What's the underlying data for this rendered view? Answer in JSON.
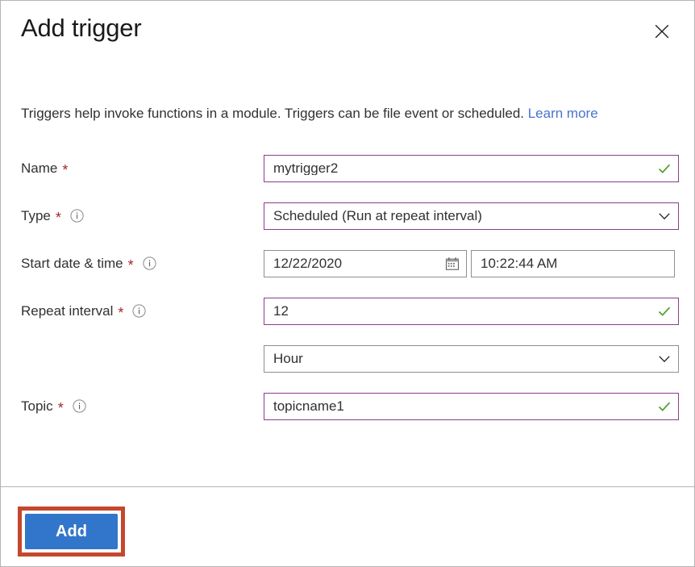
{
  "panel": {
    "title": "Add trigger",
    "close_icon": "close-icon",
    "description_text": "Triggers help invoke functions in a module. Triggers can be file event or scheduled. ",
    "learn_more_label": "Learn more"
  },
  "colors": {
    "accent_button": "#3276cb",
    "annotation": "#c4472e",
    "validated_border": "#8a3c8e",
    "neutral_border": "#8f8f8f",
    "required_star": "#a4262c",
    "link": "#4a72d0",
    "success_check": "#53a22e",
    "text": "#323130"
  },
  "form": {
    "rows": [
      {
        "label": "Name",
        "required": true,
        "required_marker": "*",
        "has_info": false,
        "info_icon": "",
        "control": {
          "type": "textbox",
          "value": "mytrigger2",
          "placeholder": "",
          "validated": true,
          "adornment_icon": "check-icon"
        }
      },
      {
        "label": "Type",
        "required": true,
        "required_marker": "*",
        "has_info": true,
        "info_icon": "info-icon",
        "control": {
          "type": "dropdown",
          "value": "Scheduled (Run at repeat interval)",
          "placeholder": "",
          "validated": true,
          "adornment_icon": "chevron-down-icon",
          "options": [
            "Scheduled (Run at repeat interval)"
          ]
        }
      },
      {
        "label": "Start date & time",
        "required": true,
        "required_marker": "*",
        "has_info": true,
        "info_icon": "info-icon",
        "control": {
          "type": "datetime",
          "date_value": "12/22/2020",
          "date_placeholder": "",
          "date_adornment_icon": "calendar-icon",
          "time_value": "10:22:44 AM",
          "time_placeholder": "",
          "validated": false
        }
      },
      {
        "label": "Repeat interval",
        "required": true,
        "required_marker": "*",
        "has_info": true,
        "info_icon": "info-icon",
        "control": {
          "type": "textbox",
          "value": "12",
          "placeholder": "",
          "validated": true,
          "adornment_icon": "check-icon"
        }
      },
      {
        "label": "",
        "required": false,
        "required_marker": "",
        "has_info": false,
        "info_icon": "",
        "control": {
          "type": "dropdown",
          "value": "Hour",
          "placeholder": "",
          "validated": false,
          "adornment_icon": "chevron-down-icon",
          "options": [
            "Hour"
          ]
        }
      },
      {
        "label": "Topic",
        "required": true,
        "required_marker": "*",
        "has_info": true,
        "info_icon": "info-icon",
        "control": {
          "type": "textbox",
          "value": "topicname1",
          "placeholder": "",
          "validated": true,
          "adornment_icon": "check-icon"
        }
      }
    ]
  },
  "footer": {
    "submit_label": "Add",
    "annotation_highlight": true
  }
}
